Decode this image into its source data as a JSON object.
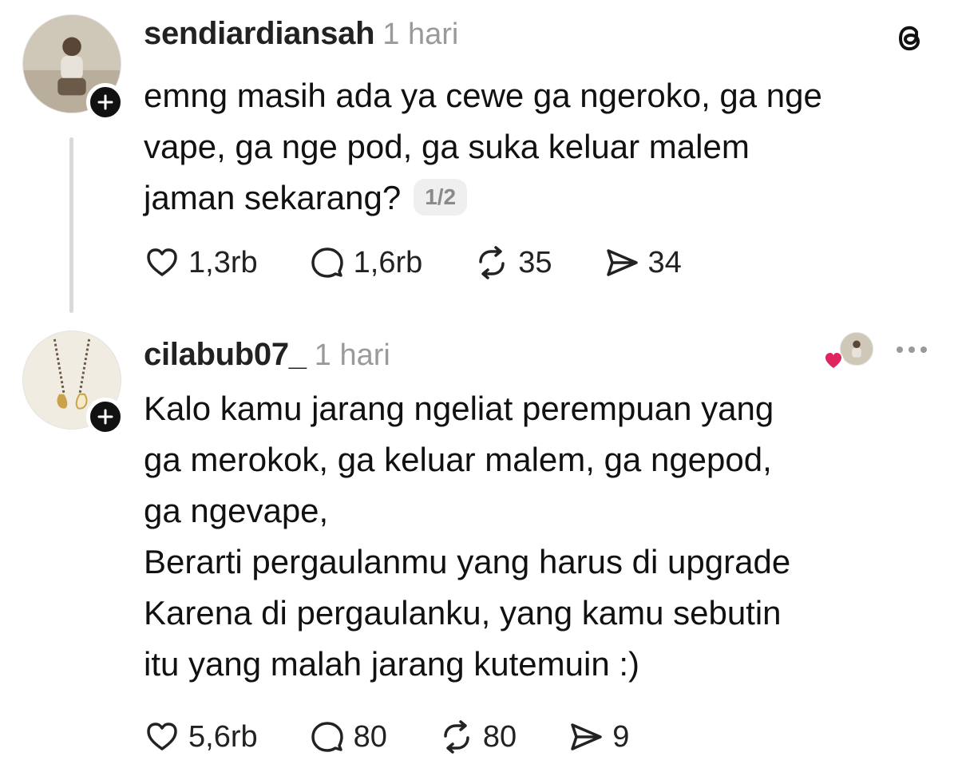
{
  "posts": [
    {
      "username": "sendiardiansah",
      "time": "1 hari",
      "lines": [
        "emng masih ada ya cewe ga ngeroko, ga nge",
        "vape, ga nge pod, ga suka keluar malem",
        "jaman sekarang?"
      ],
      "page_indicator": "1/2",
      "likes": "1,3rb",
      "replies": "1,6rb",
      "reposts": "35",
      "shares": "34"
    },
    {
      "username": "cilabub07_",
      "time": "1 hari",
      "lines": [
        "Kalo kamu jarang ngeliat perempuan yang",
        "ga merokok, ga keluar malem, ga ngepod,",
        "ga ngevape,",
        "Berarti pergaulanmu yang harus di upgrade",
        "Karena di pergaulanku, yang kamu sebutin",
        "itu yang malah jarang kutemuin :)"
      ],
      "likes": "5,6rb",
      "replies": "80",
      "reposts": "80",
      "shares": "9"
    }
  ],
  "icons": {
    "app_logo": "threads-logo-icon",
    "like": "heart-outline-icon",
    "reply": "speech-bubble-icon",
    "repost": "repost-icon",
    "share": "send-icon",
    "follow": "plus-icon",
    "more": "ellipsis-icon",
    "liked_by_author": "heart-filled-icon"
  },
  "colors": {
    "text": "#111111",
    "muted": "#9a9a9a",
    "heart": "#e0245e",
    "thread_line": "#d9d9d9"
  }
}
